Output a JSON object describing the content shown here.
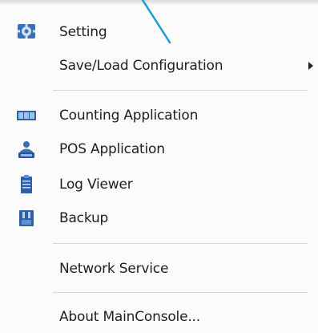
{
  "menu": {
    "items": [
      {
        "label": "Setting",
        "icon": "gear-icon"
      },
      {
        "label": "Save/Load Configuration",
        "icon": "",
        "has_submenu": true
      },
      {
        "label": "Counting Application",
        "icon": "counting-app-icon"
      },
      {
        "label": "POS Application",
        "icon": "pos-app-icon"
      },
      {
        "label": "Log Viewer",
        "icon": "log-viewer-icon"
      },
      {
        "label": "Backup",
        "icon": "backup-icon"
      },
      {
        "label": "Network Service",
        "icon": ""
      },
      {
        "label": "About MainConsole...",
        "icon": ""
      }
    ],
    "accent_color": "#2f6db5",
    "callout_color": "#1f9ad6"
  }
}
